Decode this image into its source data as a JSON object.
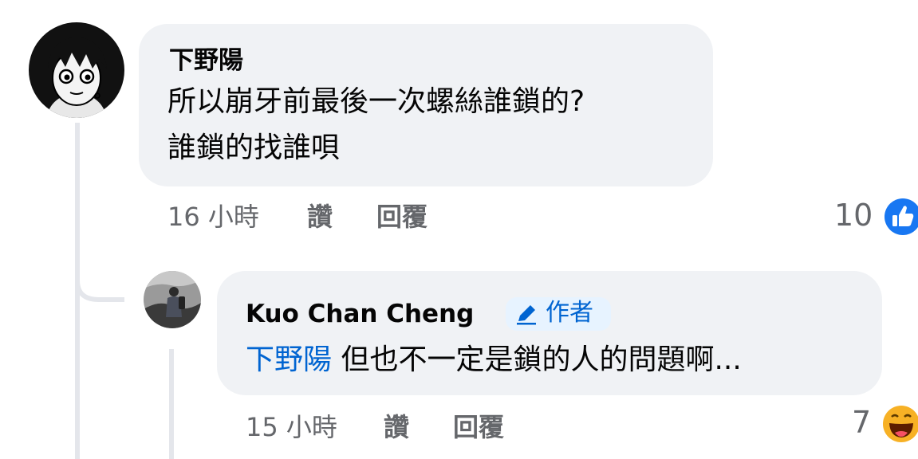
{
  "comment": {
    "author": "下野陽",
    "text_line1": "所以崩牙前最後一次螺絲誰鎖的?",
    "text_line2": "誰鎖的找誰唄",
    "time": "16 小時",
    "like_label": "讚",
    "reply_label": "回覆",
    "reaction_count": "10",
    "reaction_icon": "like-icon"
  },
  "reply": {
    "author": "Kuo Chan Cheng",
    "author_badge": "作者",
    "author_badge_icon": "pencil-icon",
    "mention": "下野陽",
    "text": "但也不一定是鎖的人的問題啊...",
    "time": "15 小時",
    "like_label": "讚",
    "reply_label": "回覆",
    "reaction_count": "7",
    "reaction_icon": "haha-icon"
  },
  "colors": {
    "bubble": "#f0f2f5",
    "link_blue": "#0064d1",
    "like_blue": "#1877f2",
    "meta_gray": "#65676b"
  }
}
